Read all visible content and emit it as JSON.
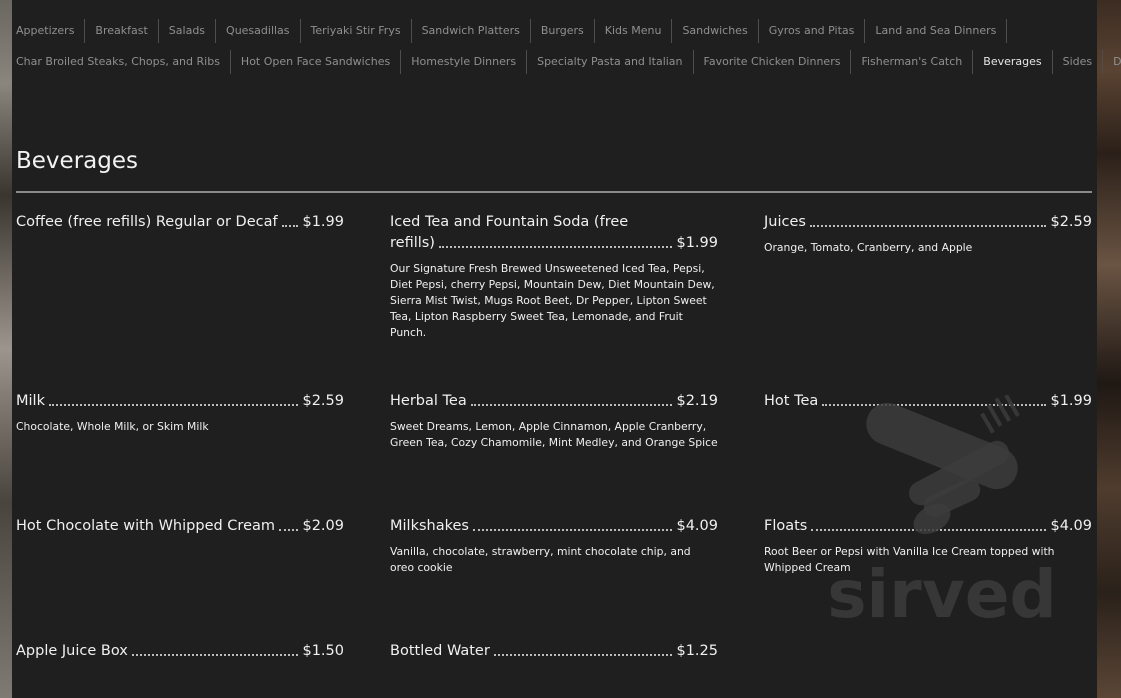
{
  "nav": {
    "row1": [
      "Appetizers",
      "Breakfast",
      "Salads",
      "Quesadillas",
      "Teriyaki Stir Frys",
      "Sandwich Platters",
      "Burgers",
      "Kids Menu",
      "Sandwiches",
      "Gyros and Pitas",
      "Land and Sea Dinners"
    ],
    "row2": [
      "Char Broiled Steaks, Chops, and Ribs",
      "Hot Open Face Sandwiches",
      "Homestyle Dinners",
      "Specialty Pasta and Italian",
      "Favorite Chicken Dinners",
      "Fisherman's Catch",
      "Beverages",
      "Sides",
      "Desserts"
    ],
    "active": "Beverages"
  },
  "section": {
    "title": "Beverages"
  },
  "items": {
    "coffee": {
      "name": "Coffee (free refills) Regular or Decaf",
      "price": "$1.99"
    },
    "iced_tea": {
      "name_line1": "Iced Tea and Fountain Soda (free",
      "name_line2": "refills)",
      "price": "$1.99",
      "desc": "Our Signature Fresh Brewed Unsweetened Iced Tea, Pepsi, Diet Pepsi, cherry Pepsi, Mountain Dew, Diet Mountain Dew, Sierra Mist Twist, Mugs Root Beet, Dr Pepper, Lipton Sweet Tea, Lipton Raspberry Sweet Tea, Lemonade, and Fruit Punch."
    },
    "juices": {
      "name": "Juices",
      "price": "$2.59",
      "desc": "Orange, Tomato, Cranberry, and Apple"
    },
    "milk": {
      "name": "Milk",
      "price": "$2.59",
      "desc": "Chocolate, Whole Milk, or Skim Milk"
    },
    "herbal_tea": {
      "name": "Herbal Tea",
      "price": "$2.19",
      "desc": "Sweet Dreams, Lemon, Apple Cinnamon, Apple Cranberry, Green Tea, Cozy Chamomile, Mint Medley, and Orange Spice"
    },
    "hot_tea": {
      "name": "Hot Tea",
      "price": "$1.99"
    },
    "hot_chocolate": {
      "name": "Hot Chocolate with Whipped Cream",
      "price": "$2.09"
    },
    "milkshakes": {
      "name": "Milkshakes",
      "price": "$4.09",
      "desc": "Vanilla, chocolate, strawberry, mint chocolate chip, and oreo cookie"
    },
    "floats": {
      "name": "Floats",
      "price": "$4.09",
      "desc": "Root Beer or Pepsi with Vanilla Ice Cream topped with Whipped Cream"
    },
    "apple_juice": {
      "name": "Apple Juice Box",
      "price": "$1.50"
    },
    "water": {
      "name": "Bottled Water",
      "price": "$1.25"
    }
  },
  "watermark": {
    "text": "sirved",
    "icon": "knife-fork-spoon-icon"
  },
  "colors": {
    "panel": "#1f1f1f",
    "text": "#f0f0f0",
    "nav_text": "#8f8f8f",
    "nav_active": "#e6e6e6"
  }
}
